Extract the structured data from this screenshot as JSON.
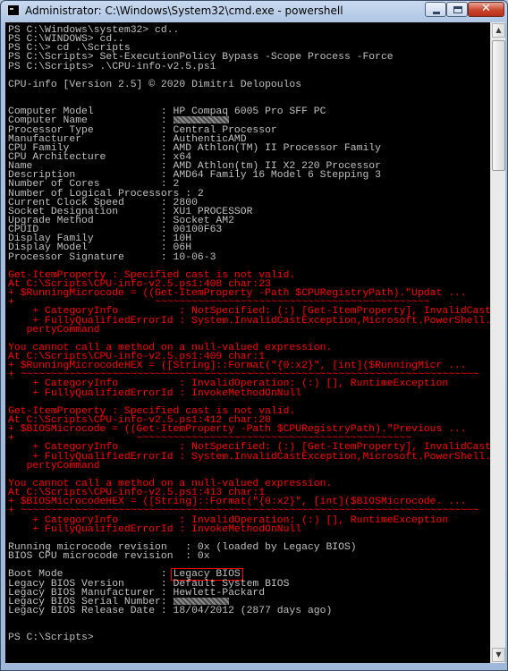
{
  "window": {
    "title": "Administrator: C:\\Windows\\System32\\cmd.exe - powershell",
    "controls": {
      "minimize": "minimize",
      "maximize": "maximize",
      "close": "✕"
    }
  },
  "console": {
    "lines": [
      {
        "t": "PS C:\\Windows\\system32> cd.."
      },
      {
        "t": "PS C:\\WINDOWS> cd.."
      },
      {
        "t": "PS C:\\> cd .\\Scripts"
      },
      {
        "t": "PS C:\\Scripts> Set-ExecutionPolicy Bypass -Scope Process -Force"
      },
      {
        "t": "PS C:\\Scripts> .\\CPU-info-v2.5.ps1"
      },
      {
        "t": ""
      },
      {
        "t": "CPU-info [Version 2.5] © 2020 Dimitri Delopoulos"
      },
      {
        "t": ""
      },
      {
        "t": ""
      },
      {
        "t": "Computer Model           : HP Compaq 6005 Pro SFF PC"
      },
      {
        "t": "Computer Name            : ",
        "redacted": true
      },
      {
        "t": "Processor Type           : Central Processor"
      },
      {
        "t": "Manufacturer             : AuthenticAMD"
      },
      {
        "t": "CPU Family               : AMD Athlon(TM) II Processor Family"
      },
      {
        "t": "CPU Architecture         : x64"
      },
      {
        "t": "Name                     : AMD Athlon(tm) II X2 220 Processor"
      },
      {
        "t": "Description              : AMD64 Family 16 Model 6 Stepping 3"
      },
      {
        "t": "Number of Cores          : 2"
      },
      {
        "t": "Number of Logical Processors : 2"
      },
      {
        "t": "Current Clock Speed      : 2800"
      },
      {
        "t": "Socket Designation       : XU1 PROCESSOR"
      },
      {
        "t": "Upgrade Method           : Socket AM2"
      },
      {
        "t": "CPUID                    : 00100F63"
      },
      {
        "t": "Display Family           : 10H"
      },
      {
        "t": "Display Model            : 06H"
      },
      {
        "t": "Processor Signature      : 10-06-3"
      },
      {
        "t": ""
      },
      {
        "t": "Get-ItemProperty : Specified cast is not valid.",
        "err": true
      },
      {
        "t": "At C:\\Scripts\\CPU-info-v2.5.ps1:408 char:23",
        "err": true
      },
      {
        "t": "+ $RunningMicrocode = ((Get-ItemProperty -Path $CPURegistryPath).\"Updat ...",
        "err": true
      },
      {
        "t": "+                       ~~~~~~~~~~~~~~~~~~~~~~~~~~~~~~~~~~~~~~~~~~~~~",
        "err": true
      },
      {
        "t": "    + CategoryInfo          : NotSpecified: (:) [Get-ItemProperty], InvalidCastE",
        "err": true
      },
      {
        "t": "    + FullyQualifiedErrorId : System.InvalidCastException,Microsoft.PowerShell.C",
        "err": true
      },
      {
        "t": "   pertyCommand",
        "err": true
      },
      {
        "t": "",
        "err": true
      },
      {
        "t": "You cannot call a method on a null-valued expression.",
        "err": true
      },
      {
        "t": "At C:\\Scripts\\CPU-info-v2.5.ps1:409 char:1",
        "err": true
      },
      {
        "t": "+ $RunningMicrocodeHEX = ([String]::Format(\"{0:x2}\", [int]($RunningMicr ...",
        "err": true
      },
      {
        "t": "+ ~~~~~~~~~~~~~~~~~~~~~~~~~~~~~~~~~~~~~~~~~~~~~~~~~~~~~~~~~~~~~~~~~~~~~~~~~~~",
        "err": true
      },
      {
        "t": "    + CategoryInfo          : InvalidOperation: (:) [], RuntimeException",
        "err": true
      },
      {
        "t": "    + FullyQualifiedErrorId : InvokeMethodOnNull",
        "err": true
      },
      {
        "t": "",
        "err": true
      },
      {
        "t": "Get-ItemProperty : Specified cast is not valid.",
        "err": true
      },
      {
        "t": "At C:\\Scripts\\CPU-info-v2.5.ps1:412 char:20",
        "err": true
      },
      {
        "t": "+ $BIOSMicrocode = ((Get-ItemProperty -Path $CPURegistryPath).\"Previous ...",
        "err": true
      },
      {
        "t": "+                    ~~~~~~~~~~~~~~~~~~~~~~~~~~~~~~~~~~~~~~~~~~~~~",
        "err": true
      },
      {
        "t": "    + CategoryInfo          : NotSpecified: (:) [Get-ItemProperty], InvalidCastE",
        "err": true
      },
      {
        "t": "    + FullyQualifiedErrorId : System.InvalidCastException,Microsoft.PowerShell.C",
        "err": true
      },
      {
        "t": "   pertyCommand",
        "err": true
      },
      {
        "t": "",
        "err": true
      },
      {
        "t": "You cannot call a method on a null-valued expression.",
        "err": true
      },
      {
        "t": "At C:\\Scripts\\CPU-info-v2.5.ps1:413 char:1",
        "err": true
      },
      {
        "t": "+ $BIOSMicrocodeHEX = ([String]::Format(\"{0:x2}\", [int]($BIOSMicrocode. ...",
        "err": true
      },
      {
        "t": "+ ~~~~~~~~~~~~~~~~~~~~~~~~~~~~~~~~~~~~~~~~~~~~~~~~~~~~~~~~~~~~~~~~~~~~~~~~~~~",
        "err": true
      },
      {
        "t": "    + CategoryInfo          : InvalidOperation: (:) [], RuntimeException",
        "err": true
      },
      {
        "t": "    + FullyQualifiedErrorId : InvokeMethodOnNull",
        "err": true
      },
      {
        "t": "",
        "err": true
      },
      {
        "t": "Running microcode revision   : 0x (loaded by Legacy BIOS)"
      },
      {
        "t": "BIOS CPU microcode revision  : 0x"
      },
      {
        "t": ""
      },
      {
        "t": "Boot Mode                : ",
        "boxed": "Legacy BIOS"
      },
      {
        "t": "Legacy BIOS Version      : Default System BIOS"
      },
      {
        "t": "Legacy BIOS Manufacturer : Hewlett-Packard"
      },
      {
        "t": "Legacy BIOS Serial Number: ",
        "redacted": true
      },
      {
        "t": "Legacy BIOS Release Date : 18/04/2012 (2877 days ago)"
      },
      {
        "t": ""
      },
      {
        "t": ""
      },
      {
        "t": "PS C:\\Scripts>"
      }
    ]
  },
  "colors": {
    "console_bg": "#000000",
    "console_fg": "#c0c0c0",
    "error_fg": "#ff0000",
    "highlight_box": "#ff0000"
  },
  "icons": {
    "app": "cmd-console-icon",
    "scroll_up": "scroll-up-arrow-icon",
    "scroll_down": "scroll-down-arrow-icon"
  },
  "scroll": {
    "up_glyph": "▲",
    "down_glyph": "▼"
  }
}
